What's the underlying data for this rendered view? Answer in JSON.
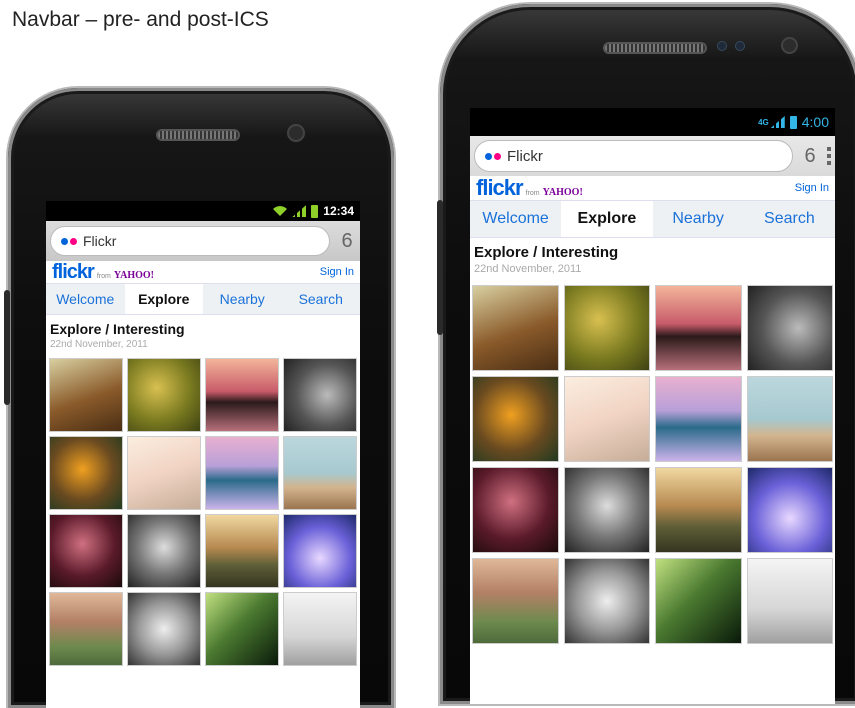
{
  "slide_title": "Navbar – pre- and post-ICS",
  "phones": {
    "left": {
      "status_time": "12:34",
      "url_text": "Flickr",
      "tab_count": "6",
      "logo_text": "flickr",
      "logo_from": "from",
      "logo_yahoo": "YAHOO!",
      "sign_in": "Sign In",
      "tabs": [
        "Welcome",
        "Explore",
        "Nearby",
        "Search"
      ],
      "active_tab": "Explore",
      "section_title": "Explore / Interesting",
      "section_date": "22nd November, 2011",
      "photo_count_visible": 16
    },
    "right": {
      "status_time": "4:00",
      "network_badge": "4G",
      "url_text": "Flickr",
      "tab_count": "6",
      "logo_text": "flickr",
      "logo_from": "from",
      "logo_yahoo": "YAHOO!",
      "sign_in": "Sign In",
      "tabs": [
        "Welcome",
        "Explore",
        "Nearby",
        "Search"
      ],
      "active_tab": "Explore",
      "section_title": "Explore / Interesting",
      "section_date": "22nd November, 2011",
      "photo_count_visible": 16
    }
  },
  "colors": {
    "flickr_blue": "#0063dc",
    "flickr_pink": "#ff0084",
    "tab_link": "#1a72d9",
    "gingerbread_status_green": "#8ecf2a",
    "ics_status_blue": "#33b5e5"
  },
  "icons": [
    "wifi-icon",
    "signal-icon",
    "battery-icon",
    "flickr-dots-icon",
    "tab-count-icon",
    "overflow-menu-icon"
  ]
}
